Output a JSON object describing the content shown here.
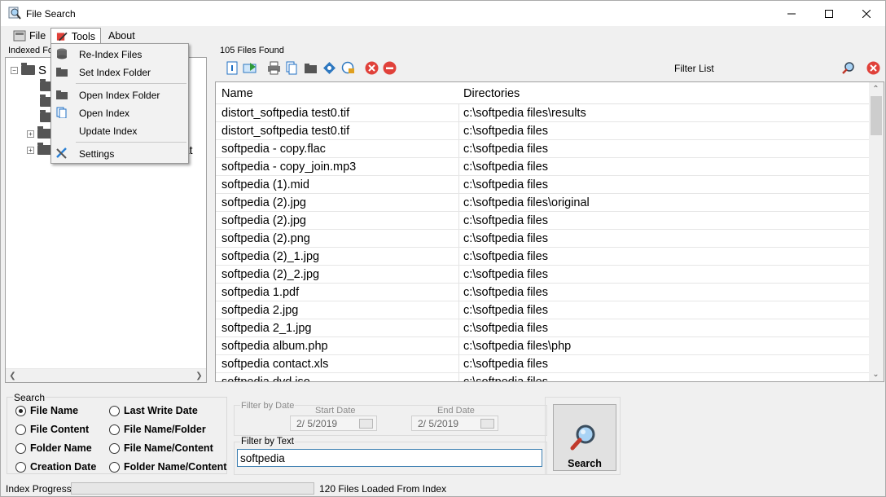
{
  "window": {
    "title": "File Search"
  },
  "menubar": {
    "file": "File",
    "tools": "Tools",
    "about": "About"
  },
  "tools_menu": {
    "items": [
      {
        "label": "Re-Index Files",
        "icon": "database-icon"
      },
      {
        "label": "Set Index Folder",
        "icon": "folder-icon"
      },
      {
        "label": "Open Index Folder",
        "icon": "folder-icon"
      },
      {
        "label": "Open Index",
        "icon": "copy-icon"
      },
      {
        "label": "Update Index",
        "icon": ""
      },
      {
        "label": "Settings",
        "icon": "tools-icon"
      }
    ]
  },
  "left_panel": {
    "label": "Indexed Fo",
    "tree": {
      "root_label": "S",
      "partial_label": "dat"
    }
  },
  "right_panel": {
    "files_found": "105 Files Found",
    "filter_list_label": "Filter List",
    "columns": [
      "Name",
      "Directories"
    ],
    "rows": [
      [
        "distort_softpedia test0.tif",
        "c:\\softpedia files\\results"
      ],
      [
        "distort_softpedia test0.tif",
        "c:\\softpedia files"
      ],
      [
        "softpedia - copy.flac",
        "c:\\softpedia files"
      ],
      [
        "softpedia - copy_join.mp3",
        "c:\\softpedia files"
      ],
      [
        "softpedia (1).mid",
        "c:\\softpedia files"
      ],
      [
        "softpedia (2).jpg",
        "c:\\softpedia files\\original"
      ],
      [
        "softpedia (2).jpg",
        "c:\\softpedia files"
      ],
      [
        "softpedia (2).png",
        "c:\\softpedia files"
      ],
      [
        "softpedia (2)_1.jpg",
        "c:\\softpedia files"
      ],
      [
        "softpedia (2)_2.jpg",
        "c:\\softpedia files"
      ],
      [
        "softpedia 1.pdf",
        "c:\\softpedia files"
      ],
      [
        "softpedia 2.jpg",
        "c:\\softpedia files"
      ],
      [
        "softpedia 2_1.jpg",
        "c:\\softpedia files"
      ],
      [
        "softpedia album.php",
        "c:\\softpedia files\\php"
      ],
      [
        "softpedia contact.xls",
        "c:\\softpedia files"
      ],
      [
        "softpedia dvd.iso",
        "c:\\softpedia files"
      ]
    ]
  },
  "search_options": {
    "title": "Search",
    "options": [
      {
        "label": "File Name",
        "selected": true
      },
      {
        "label": "File Content",
        "selected": false
      },
      {
        "label": "Folder Name",
        "selected": false
      },
      {
        "label": "Creation Date",
        "selected": false
      },
      {
        "label": "Last Write Date",
        "selected": false
      },
      {
        "label": "File Name/Folder",
        "selected": false
      },
      {
        "label": "File Name/Content",
        "selected": false
      },
      {
        "label": "Folder Name/Content",
        "selected": false
      }
    ]
  },
  "filter_by_date": {
    "title": "Filter by Date",
    "start_label": "Start Date",
    "end_label": "End Date",
    "start_value": "2/  5/2019",
    "end_value": "2/  5/2019"
  },
  "filter_by_text": {
    "title": "Filter by Text",
    "value": "softpedia"
  },
  "search_button": {
    "label": "Search"
  },
  "status": {
    "progress_label": "Index Progress",
    "progress_value": 0,
    "message": "120 Files Loaded From Index"
  },
  "colors": {
    "accent_red": "#e0413a",
    "input_border": "#3c7fb1"
  }
}
